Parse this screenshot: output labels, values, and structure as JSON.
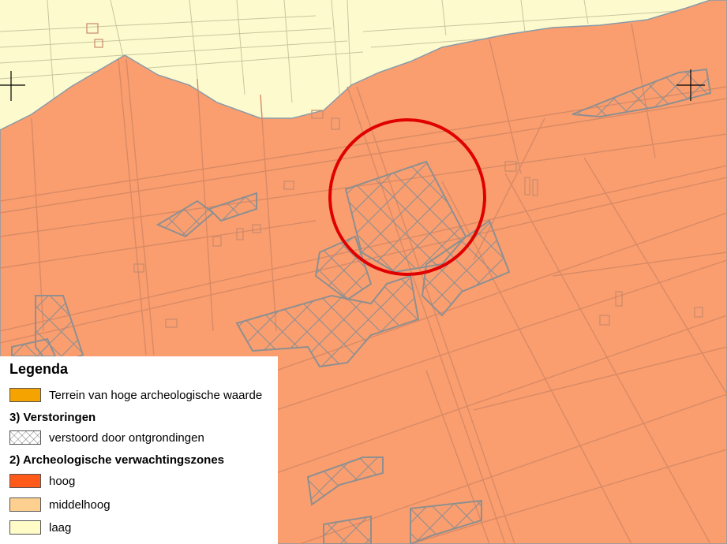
{
  "colors": {
    "laag_zone": "#fdfacd",
    "hoog_zone": "#fa9e70",
    "field_lines": "#d98a65",
    "hatch": "#8f8f8f",
    "marker_circle": "#e00000",
    "crosshair": "#000000"
  },
  "legend": {
    "title": "Legenda",
    "items": [
      {
        "label": "Terrein van hoge archeologische waarde",
        "color": "#f5a300"
      }
    ],
    "section3": {
      "heading": "3) Verstoringen",
      "items": [
        {
          "label": "verstoord door ontgrondingen",
          "pattern": "crosshatch"
        }
      ]
    },
    "section2": {
      "heading": "2) Archeologische verwachtingszones",
      "items": [
        {
          "label": "hoog",
          "color": "#ff5a1a"
        },
        {
          "label": "middelhoog",
          "color": "#fed090"
        },
        {
          "label": "laag",
          "color": "#fffcc8"
        }
      ]
    }
  },
  "map": {
    "icons": [
      "crosshair-icon",
      "crosshair-icon"
    ],
    "highlight": "red-circle-marker"
  }
}
